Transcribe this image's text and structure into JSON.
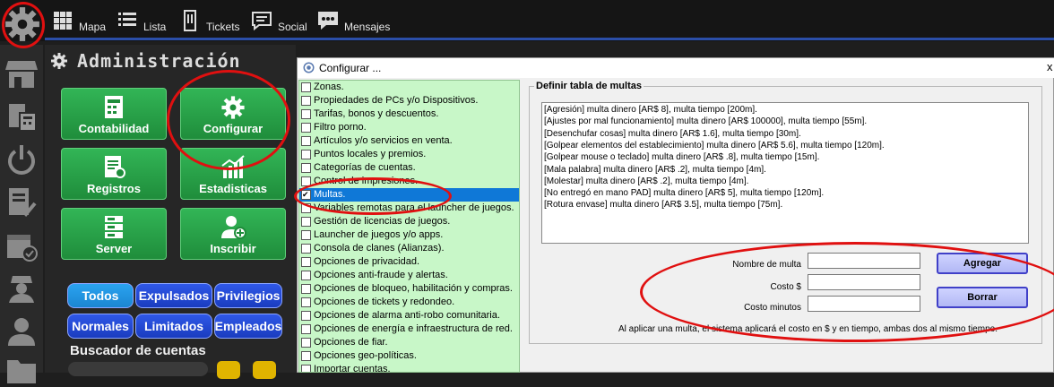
{
  "topbar": {
    "tabs": [
      {
        "label": "Mapa",
        "icon": "grid-icon"
      },
      {
        "label": "Lista",
        "icon": "list-icon"
      },
      {
        "label": "Tickets",
        "icon": "ticket-icon"
      },
      {
        "label": "Social",
        "icon": "chat-icon"
      },
      {
        "label": "Mensajes",
        "icon": "message-icon"
      }
    ]
  },
  "admin": {
    "title": "Administración",
    "buttons": [
      "Contabilidad",
      "Configurar",
      "Registros",
      "Estadisticas",
      "Server",
      "Inscribir"
    ],
    "filters": [
      "Todos",
      "Expulsados",
      "Privilegios",
      "Normales",
      "Limitados",
      "Empleados"
    ],
    "search_label": "Buscador de cuentas"
  },
  "dialog": {
    "title": "Configurar ...",
    "close": "x",
    "items": [
      "Zonas.",
      "Propiedades de PCs y/o Dispositivos.",
      "Tarifas, bonos y descuentos.",
      "Filtro porno.",
      "Artículos y/o servicios en venta.",
      "Puntos locales y premios.",
      "Categorías de cuentas.",
      "Control de impresiones.",
      "Multas.",
      "Variables remotas para el launcher de juegos.",
      "Gestión de licencias de juegos.",
      "Launcher de juegos y/o apps.",
      "Consola de clanes (Alianzas).",
      "Opciones de privacidad.",
      "Opciones anti-fraude y alertas.",
      "Opciones de bloqueo, habilitación y compras.",
      "Opciones de tickets y redondeo.",
      "Opciones de alarma anti-robo comunitaria.",
      "Opciones de energía e infraestructura de red.",
      "Opciones de fiar.",
      "Opciones geo-políticas.",
      "Importar cuentas."
    ],
    "selected_index": 8,
    "group_label": "Definir tabla de multas",
    "fines": [
      "[Agresión] multa dinero [AR$ 8], multa tiempo [200m].",
      "[Ajustes por mal funcionamiento] multa dinero [AR$ 100000], multa tiempo [55m].",
      "[Desenchufar cosas] multa dinero [AR$ 1.6], multa tiempo [30m].",
      "[Golpear elementos del establecimiento] multa dinero [AR$ 5.6], multa tiempo [120m].",
      "[Golpear mouse o teclado] multa dinero [AR$ .8], multa tiempo [15m].",
      "[Mala palabra] multa dinero [AR$ .2], multa tiempo [4m].",
      "[Molestar] multa dinero [AR$ .2], multa tiempo [4m].",
      "[No entregó en mano PAD] multa dinero [AR$ 5], multa tiempo [120m].",
      "[Rotura envase] multa dinero [AR$ 3.5], multa tiempo [75m]."
    ],
    "form": {
      "nombre_label": "Nombre de multa",
      "costo_label": "Costo $",
      "minutos_label": "Costo minutos",
      "nombre_value": "",
      "costo_value": "",
      "minutos_value": ""
    },
    "agregar": "Agregar",
    "borrar": "Borrar",
    "notice": "Al aplicar una multa, el sistema aplicará el costo en $ y en tiempo, ambas dos al mismo tiempo."
  },
  "colors": {
    "accent": "#2b4ea8",
    "green": "#1f8d3b",
    "annotation": "#e01010",
    "selection": "#0f78d7"
  }
}
